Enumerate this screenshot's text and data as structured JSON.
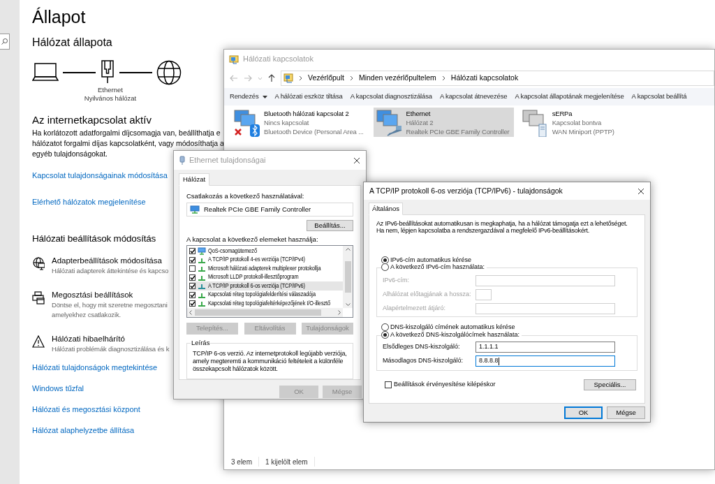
{
  "settings": {
    "title": "Állapot",
    "status_heading": "Hálózat állapota",
    "diagram": {
      "adapter": "Ethernet",
      "network": "Nyilvános hálózat"
    },
    "connection_heading": "Az internetkapcsolat aktív",
    "connection_text": [
      "Ha korlátozott adatforgalmi díjcsomagja van, beállíthatja e",
      "hálózatot forgalmi díjas kapcsolatként, vagy módosíthatja a",
      "egyéb tulajdonságokat."
    ],
    "connection_links": [
      "Kapcsolat tulajdonságainak módosítása",
      "Elérhető hálózatok megjelenítése"
    ],
    "change_heading": "Hálózati beállítások módosítás",
    "options": [
      {
        "kind": "adapter",
        "title": "Adapterbeállítások módosítása",
        "description": [
          "Hálózati adapterek áttekintése és kapcso"
        ]
      },
      {
        "kind": "sharing",
        "title": "Megosztási beállítások",
        "description": [
          "Döntse el, hogy mit szeretne megosztani",
          "amelyekhez csatlakozik."
        ]
      },
      {
        "kind": "troubleshoot",
        "title": "Hálózati hibaelhárító",
        "description": [
          "Hálózati problémák diagnosztizálása és k"
        ]
      }
    ],
    "links": [
      "Hálózati tulajdonságok megtekintése",
      "Windows tűzfal",
      "Hálózati és megosztási központ",
      "Hálózat alaphelyzetbe állítása"
    ]
  },
  "connections_window": {
    "title": "Hálózati kapcsolatok",
    "breadcrumb": [
      "Vezérlőpult",
      "Minden vezérlőpultelem",
      "Hálózati kapcsolatok"
    ],
    "commands": [
      {
        "kind": "menu",
        "label": "Rendezés"
      },
      {
        "kind": "command",
        "label": "A hálózati eszköz tiltása"
      },
      {
        "kind": "command",
        "label": "A kapcsolat diagnosztizálása"
      },
      {
        "kind": "command",
        "label": "A kapcsolat átnevezése"
      },
      {
        "kind": "command",
        "label": "A kapcsolat állapotának megjelenítése"
      },
      {
        "kind": "command",
        "label": "A kapcsolat beállítá"
      }
    ],
    "connections": [
      {
        "kind": "bluetooth",
        "name": "Bluetooth hálózati kapcsolat 2",
        "status": "Nincs kapcsolat",
        "device": "Bluetooth Device (Personal Area ...",
        "selected": false
      },
      {
        "kind": "ethernet",
        "name": "Ethernet",
        "status": "Hálózat 2",
        "device": "Realtek PCIe GBE Family Controller",
        "selected": true
      },
      {
        "kind": "vpn",
        "name": "sERPa",
        "status": "Kapcsolat bontva",
        "device": "WAN Miniport (PPTP)",
        "selected": false
      }
    ],
    "status_bar": [
      "3 elem",
      "1 kijelölt elem"
    ]
  },
  "ethernet_dialog": {
    "title": "Ethernet tulajdonságai",
    "tabs": [
      {
        "label": "Hálózat",
        "selected": true
      }
    ],
    "connect_label": "Csatlakozás a következő használatával:",
    "adapter": "Realtek PCIe GBE Family Controller",
    "configure_button": "Beállítás...",
    "items_label": "A kapcsolat a következő elemeket használja:",
    "items": [
      {
        "kind": "scheduler",
        "label": "QoS-csomagütemező",
        "checked": true,
        "selected": false
      },
      {
        "kind": "protocol",
        "label": "A TCP/IP protokoll 4-es verziója (TCP/IPv4)",
        "checked": true,
        "selected": false
      },
      {
        "kind": "protocol",
        "label": "Microsoft hálózati adapterek multiplexer protokollja",
        "checked": false,
        "selected": false
      },
      {
        "kind": "protocol",
        "label": "Microsoft LLDP protokoll-illesztőprogram",
        "checked": true,
        "selected": false
      },
      {
        "kind": "protocol",
        "label": "A TCP/IP protokoll 6-os verziója (TCP/IPv6)",
        "checked": true,
        "selected": true
      },
      {
        "kind": "protocol",
        "label": "Kapcsolati réteg topológiafelderítési válaszadója",
        "checked": true,
        "selected": false
      },
      {
        "kind": "protocol",
        "label": "Kapcsolati réteg topológiafeltérképezőjének I/O-illesztő",
        "checked": true,
        "selected": false
      }
    ],
    "item_buttons": [
      {
        "label": "Telepítés...",
        "disabled": true
      },
      {
        "label": "Eltávolítás",
        "disabled": true
      },
      {
        "label": "Tulajdonságok",
        "disabled": true
      }
    ],
    "description_title": "Leírás",
    "description": [
      "TCP/IP 6-os verzió. Az internetprotokoll legújabb verziója,",
      "amely megteremti a kommunikáció feltételeit a különféle",
      "összekapcsolt hálózatok között."
    ],
    "buttons": [
      {
        "label": "OK",
        "disabled": true
      },
      {
        "label": "Mégse",
        "disabled": true
      }
    ]
  },
  "ipv6_dialog": {
    "title": "A TCP/IP protokoll 6-os verziója (TCP/IPv6) - tulajdonságok",
    "tabs": [
      {
        "label": "Általános",
        "selected": true
      }
    ],
    "intro": [
      "Az IPv6-beállításokat automatikusan is megkaphatja, ha a hálózat támogatja ezt a lehetőséget.",
      "Ha nem, lépjen kapcsolatba a rendszergazdával a megfelelő IPv6-beállításokért."
    ],
    "address_options": [
      {
        "label": "IPv6-cím automatikus kérése",
        "selected": true
      },
      {
        "label": "A következő IPv6-cím használata:",
        "selected": false
      }
    ],
    "address_fields": [
      {
        "kind": "wide",
        "label": "IPv6-cím:",
        "disabled": true
      },
      {
        "kind": "short",
        "label": "Alhálózat előtagjának a hossza:",
        "disabled": true
      },
      {
        "kind": "wide",
        "label": "Alapértelmezett átjáró:",
        "disabled": true
      }
    ],
    "dns_options": [
      {
        "label": "DNS-kiszolgáló címének automatikus kérése",
        "selected": false
      },
      {
        "label": "A következő DNS-kiszolgálócímek használata:",
        "selected": true
      }
    ],
    "dns_fields": [
      {
        "label": "Elsődleges DNS-kiszolgáló:",
        "value": "1.1.1.1",
        "focused": false
      },
      {
        "label": "Másodlagos DNS-kiszolgáló:",
        "value": "8.8.8.8",
        "focused": true
      }
    ],
    "validate_checkbox": {
      "label": "Beállítások érvényesítése kilépéskor",
      "checked": false
    },
    "advanced_button": "Speciális...",
    "buttons": [
      {
        "label": "OK",
        "default": true
      },
      {
        "label": "Mégse",
        "default": false
      }
    ]
  }
}
